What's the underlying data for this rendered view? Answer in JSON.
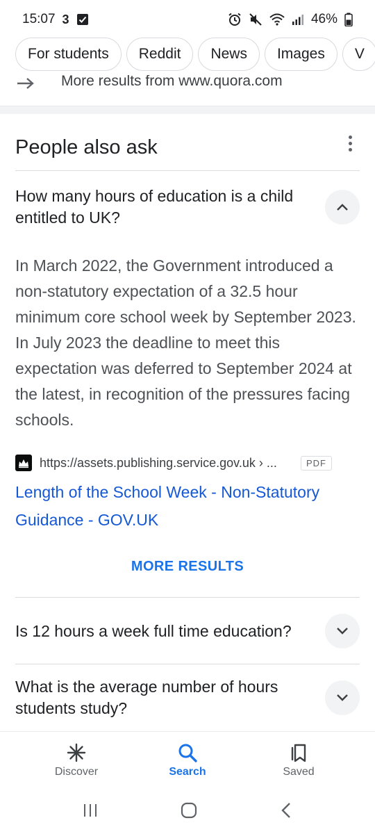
{
  "status_bar": {
    "time": "15:07",
    "carrier_glyph": "3",
    "battery": "46%"
  },
  "chips": [
    "For students",
    "Reddit",
    "News",
    "Images",
    "V"
  ],
  "more_results_source": {
    "text": "More results from www.quora.com"
  },
  "people_also_ask": {
    "title": "People also ask",
    "expanded": {
      "question": "How many hours of education is a child entitled to UK?",
      "answer": "In March 2022, the Government introduced a non-statutory expectation of a 32.5 hour minimum core school week by September 2023. In July 2023 the deadline to meet this expectation was deferred to September 2024 at the latest, in recognition of the pressures facing schools.",
      "source_url": "https://assets.publishing.service.gov.uk › ...",
      "source_badge": "PDF",
      "result_title": "Length of the School Week - Non-Statutory Guidance - GOV.UK"
    },
    "more_results_label": "MORE RESULTS",
    "collapsed": [
      {
        "question": "Is 12 hours a week full time education?"
      },
      {
        "question": "What is the average number of hours students study?"
      }
    ]
  },
  "bottom_nav": {
    "items": [
      {
        "label": "Discover",
        "icon": "asterisk-icon"
      },
      {
        "label": "Search",
        "icon": "search-icon"
      },
      {
        "label": "Saved",
        "icon": "bookmark-icon"
      }
    ],
    "active": "Search"
  },
  "colors": {
    "link": "#1558d6",
    "accent": "#1a73e8",
    "text": "#202124",
    "secondary_text": "#4d5156"
  }
}
